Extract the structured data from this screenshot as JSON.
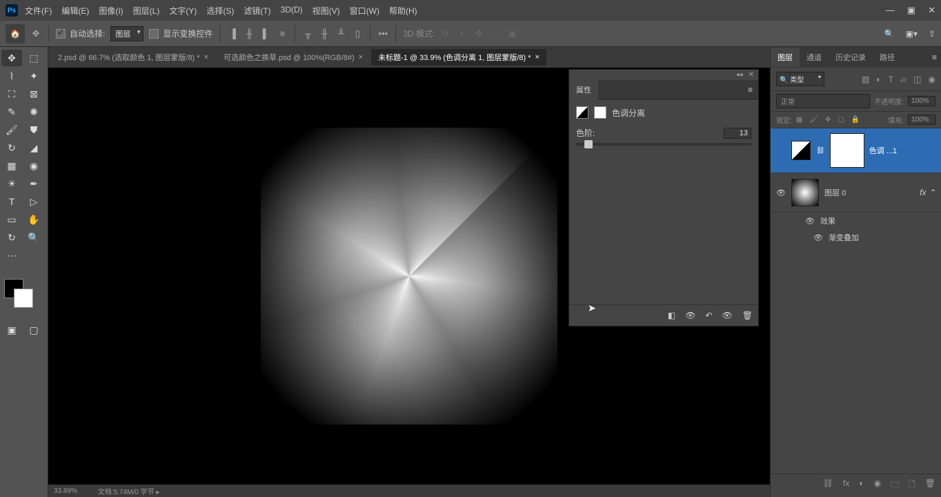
{
  "menu": [
    "文件(F)",
    "编辑(E)",
    "图像(I)",
    "图层(L)",
    "文字(Y)",
    "选择(S)",
    "滤镜(T)",
    "3D(D)",
    "视图(V)",
    "窗口(W)",
    "帮助(H)"
  ],
  "optbar": {
    "auto_select": "自动选择:",
    "layer_select": "图层",
    "show_transform": "显示变换控件",
    "mode_3d": "3D 模式:"
  },
  "tabs": [
    {
      "label": "2.psd @ 66.7% (选取颜色 1, 图层蒙版/8) *",
      "active": false
    },
    {
      "label": "可选颜色之换草.psd @ 100%(RGB/8#)",
      "active": false
    },
    {
      "label": "未标题-1 @ 33.9% (色调分离 1, 图层蒙版/8) *",
      "active": true
    }
  ],
  "status": {
    "zoom": "33.89%",
    "docinfo": "文档:5.74M/0 字节"
  },
  "props": {
    "title": "属性",
    "adj_name": "色调分离",
    "level_label": "色阶:",
    "level_value": "13"
  },
  "panels": {
    "tabs": [
      "图层",
      "通道",
      "历史记录",
      "路径"
    ]
  },
  "layers_panel": {
    "kind": "类型",
    "blend": "正常",
    "opacity_label": "不透明度:",
    "opacity": "100%",
    "lock_label": "锁定:",
    "fill_label": "填充:",
    "fill": "100%",
    "layers": [
      {
        "name": "色调 ...1",
        "type": "adj",
        "active": true,
        "visible": false
      },
      {
        "name": "图层 0",
        "type": "normal",
        "active": false,
        "visible": true,
        "fx": true
      }
    ],
    "fx_label": "效果",
    "fx_item": "渐变叠加"
  }
}
